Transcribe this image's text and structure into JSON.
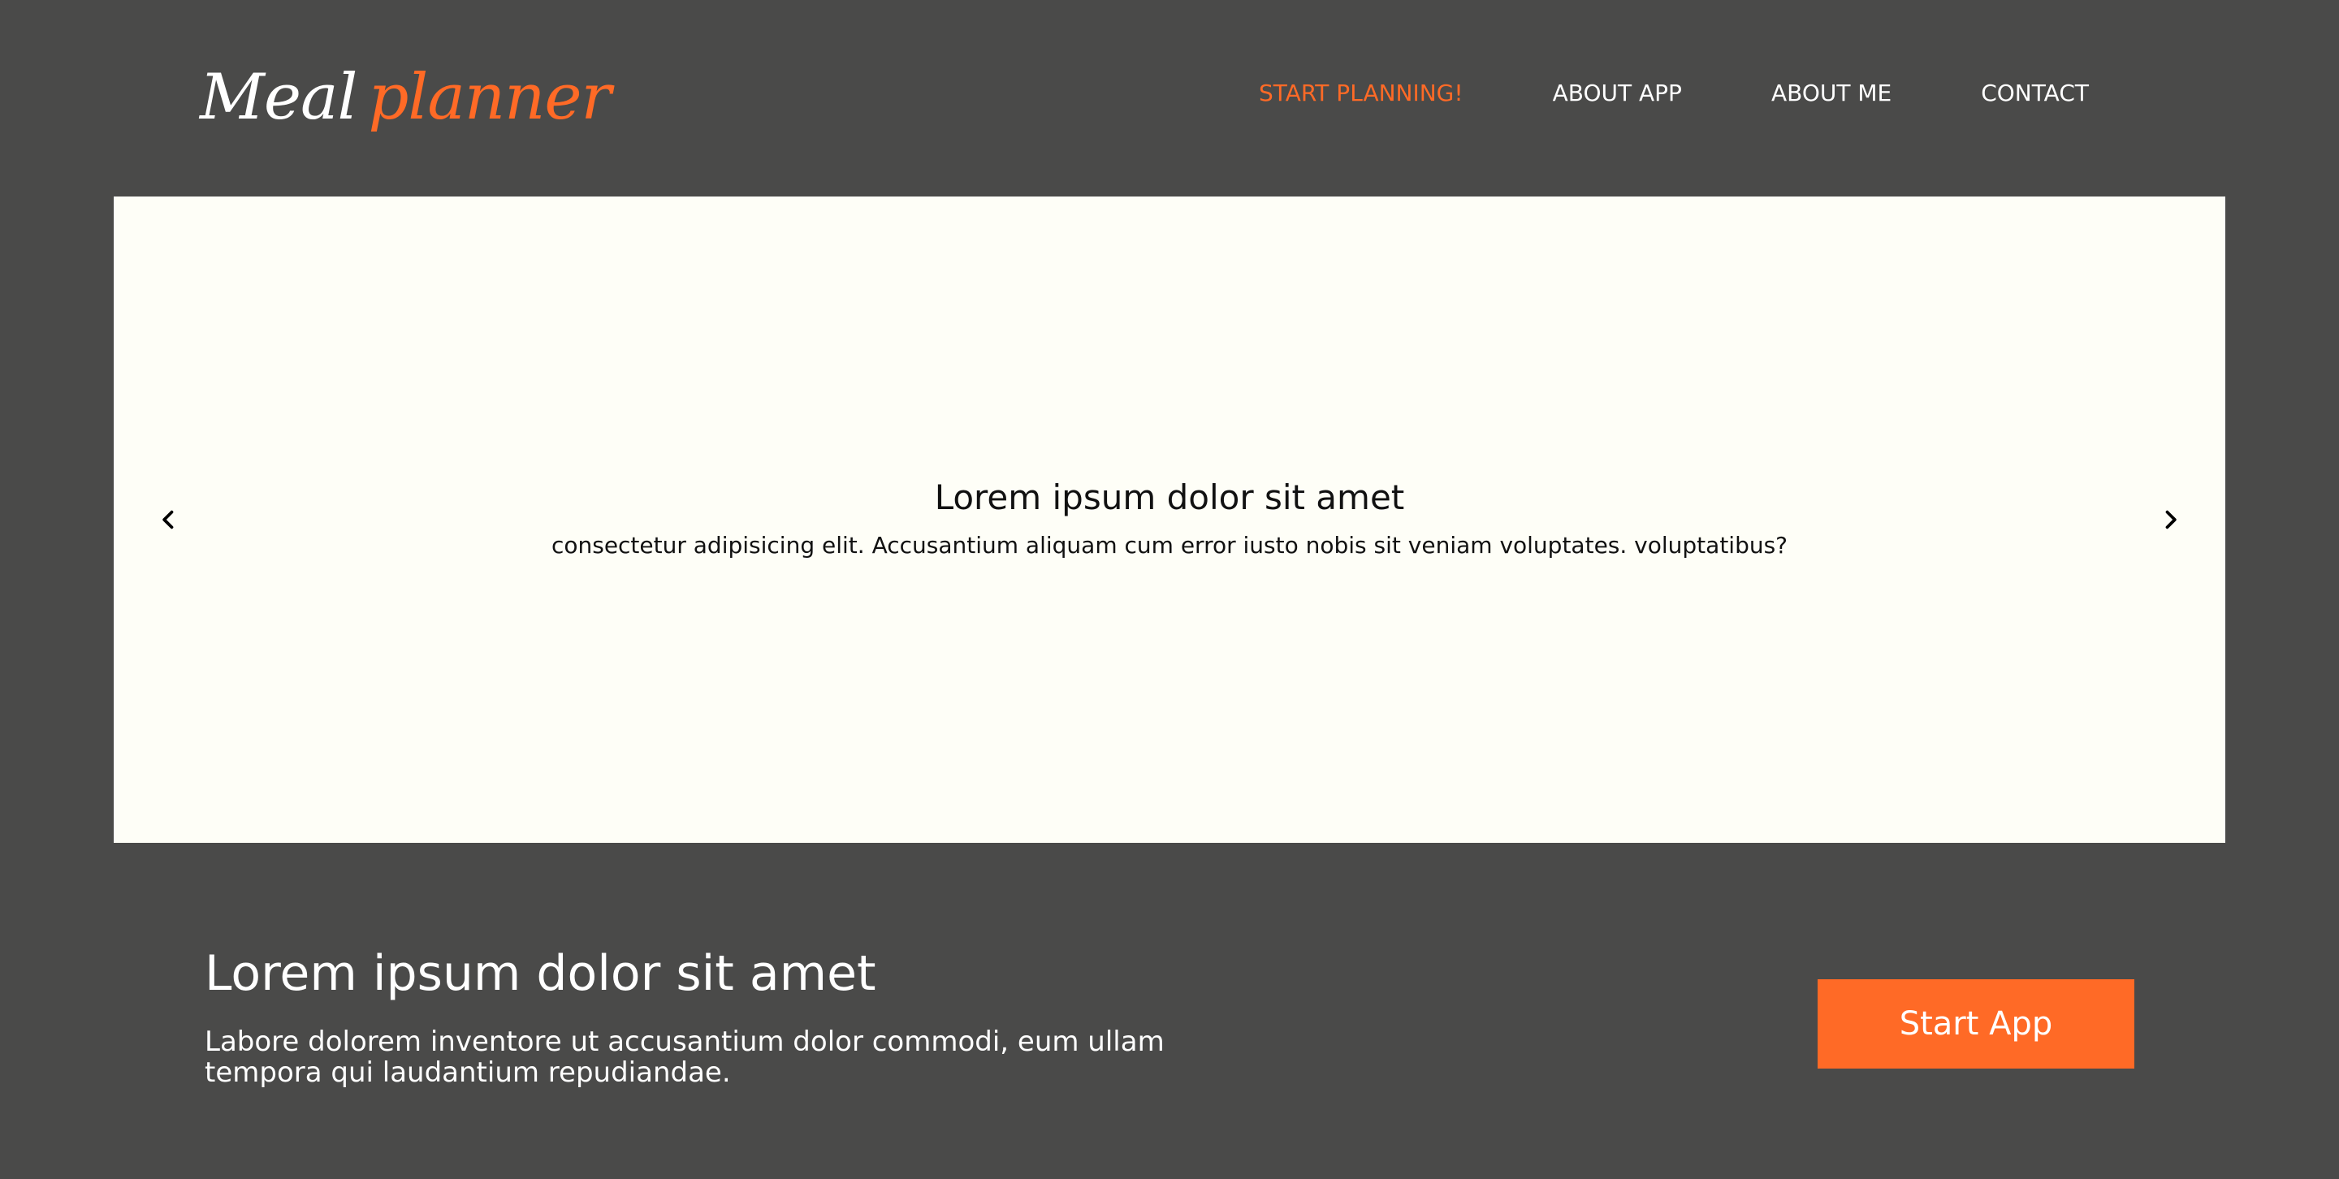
{
  "header": {
    "logo": {
      "word1": "Meal",
      "word2": "planner"
    },
    "nav": [
      {
        "label": "START PLANNING!",
        "active": true
      },
      {
        "label": "ABOUT APP",
        "active": false
      },
      {
        "label": "ABOUT ME",
        "active": false
      },
      {
        "label": "CONTACT",
        "active": false
      }
    ]
  },
  "carousel": {
    "title": "Lorem ipsum dolor sit amet",
    "text": "consectetur adipisicing elit. Accusantium aliquam cum error iusto nobis sit veniam voluptates. voluptatibus?",
    "prev_icon": "chevron-left-icon",
    "next_icon": "chevron-right-icon"
  },
  "intro": {
    "title": "Lorem ipsum dolor sit amet",
    "text": "Labore dolorem inventore ut accusantium dolor commodi, eum ullam tempora qui laudantium repudiandae."
  },
  "cta": {
    "label": "Start App"
  },
  "colors": {
    "background": "#4a4a49",
    "accent": "#ff6a26",
    "carousel_bg": "#fefef7",
    "text_light": "#ffffff",
    "text_dark": "#111111"
  }
}
